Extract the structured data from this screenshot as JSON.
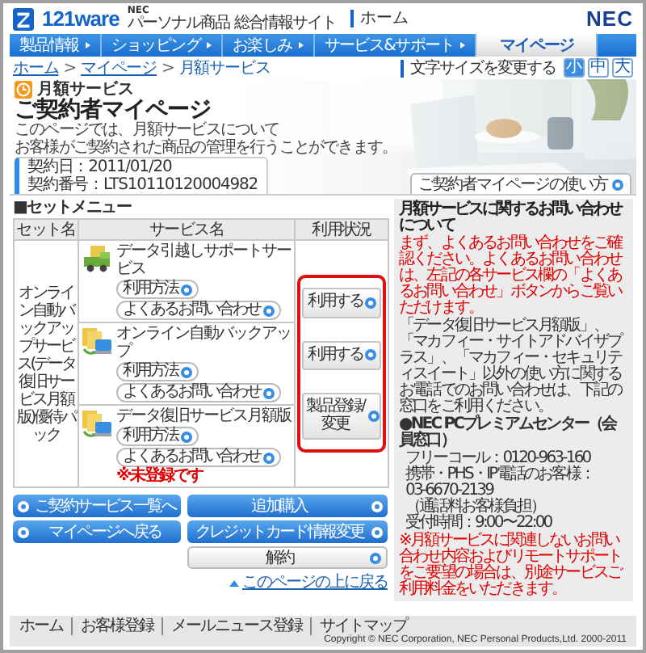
{
  "header": {
    "logo": "121ware",
    "tagline_brand": "NEC",
    "tagline": [
      "パーソナル商品",
      "総合情報サイト"
    ],
    "home_link": "ホーム",
    "brand": "NEC"
  },
  "nav": [
    {
      "label": "製品情報",
      "selected": false
    },
    {
      "label": "ショッピング",
      "selected": false
    },
    {
      "label": "お楽しみ",
      "selected": false
    },
    {
      "label": "サービス&サポート",
      "selected": false
    },
    {
      "label": "マイページ",
      "selected": true
    }
  ],
  "breadcrumb": [
    {
      "kind": "link",
      "label": "ホーム"
    },
    {
      "kind": "separator",
      "label": ">"
    },
    {
      "kind": "link",
      "label": "マイページ"
    },
    {
      "kind": "separator",
      "label": ">"
    },
    {
      "kind": "current",
      "label": "月額サービス"
    }
  ],
  "font_size": {
    "label": "文字サイズを変更する",
    "options": [
      {
        "label": "小",
        "selected": true
      },
      {
        "label": "中",
        "selected": false
      },
      {
        "label": "大",
        "selected": false
      }
    ]
  },
  "hero": {
    "category": "月額サービス",
    "title": "ご契約者マイページ",
    "description": [
      "このページでは、月額サービスについて",
      "お客様がご契約された商品の管理を行うことができます。"
    ],
    "contract": [
      "契約日：2011/01/20",
      "契約番号：LTS10110120004982"
    ],
    "guide_button": "ご契約者マイページの使い方"
  },
  "set_menu": {
    "heading": "■セットメニュー",
    "columns": [
      "セット名",
      "サービス名",
      "利用状況"
    ],
    "set_name": "オンライン自動バックアップサービス(データ復旧サービス月額版)優待パック",
    "status_highlight": true,
    "services": [
      {
        "kind": "transfer",
        "name": "データ引越しサポートサービス",
        "links": [
          "利用方法",
          "よくあるお問い合わせ"
        ],
        "action": "利用する"
      },
      {
        "kind": "backup",
        "name": "オンライン自動バックアップ",
        "links": [
          "利用方法",
          "よくあるお問い合わせ"
        ],
        "action": "利用する"
      },
      {
        "kind": "backup",
        "name": "データ復旧サービス月額版",
        "links": [
          "利用方法",
          "よくあるお問い合わせ"
        ],
        "note": "※未登録です",
        "action": "製品登録/変更"
      }
    ]
  },
  "actions": {
    "left": [
      {
        "label": "ご契約サービス一覧へ",
        "kind": "primary"
      },
      {
        "label": "マイページへ戻る",
        "kind": "primary"
      }
    ],
    "right": [
      {
        "label": "追加購入",
        "kind": "primary"
      },
      {
        "label": "クレジットカード情報変更",
        "kind": "primary"
      },
      {
        "label": "解約",
        "kind": "secondary"
      }
    ]
  },
  "sidebar": {
    "title": "月額サービスに関するお問い合わせについて",
    "notice": "まず、よくあるお問い合わせをご確認ください。よくあるお問い合わせは、左記の各サービス欄の「よくあるお問い合わせ」ボタンからご覧いただけます。",
    "body": "「データ復旧サービス月額版」、「マカフィー・サイトアドバイザプラス」、「マカフィー・セキュリティスイート」以外の使い方に関するお電話でのお問い合わせは、下記の窓口をご利用ください。",
    "center": "●NEC PCプレミアムセンター（会員窓口）",
    "lines": [
      "フリーコール：0120-963-160",
      "携帯・PHS・IP電話のお客様：",
      "03-6670-2139",
      "（通話料お客様負担）",
      "受付時間：9:00〜22:00"
    ],
    "note": "※月額サービスに関連しないお問い合わせ内容およびリモートサポートをご要望の場合は、別途サービスご利用料金をいただきます。"
  },
  "back_to_top": "このページの上に戻る",
  "footer": {
    "links": [
      "ホーム",
      "お客様登録",
      "メールニュース登録",
      "サイトマップ"
    ],
    "copyright": "Copyright © NEC Corporation, NEC Personal Products,Ltd. 2000-2011"
  }
}
